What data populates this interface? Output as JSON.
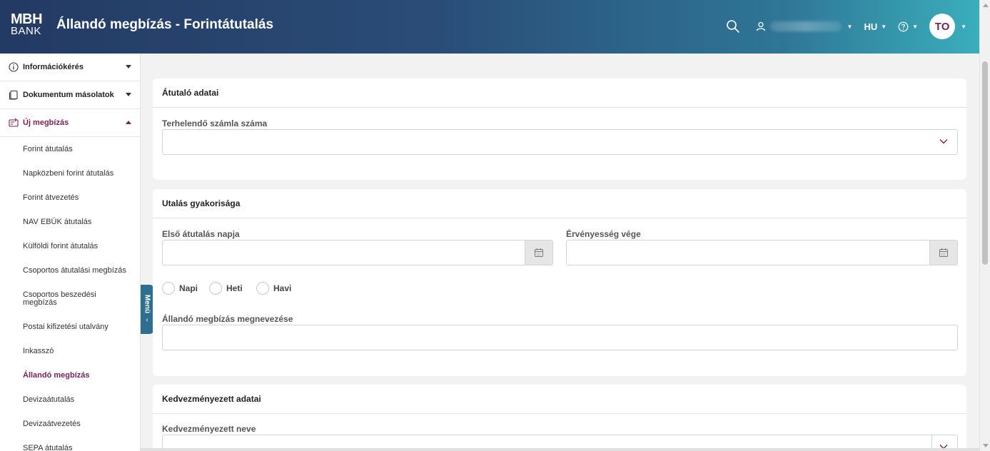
{
  "header": {
    "logo_line1": "MBH",
    "logo_line2": "BANK",
    "title": "Állandó megbízás - Forintátutalás",
    "language": "HU",
    "avatar_initials": "TO"
  },
  "sidebar": {
    "groups": [
      {
        "label": "Információkérés"
      },
      {
        "label": "Dokumentum másolatok"
      },
      {
        "label": "Új megbízás"
      }
    ],
    "items": [
      {
        "label": "Forint átutalás"
      },
      {
        "label": "Napközbeni forint átutalás"
      },
      {
        "label": "Forint átvezetés"
      },
      {
        "label": "NAV EBÜK átutalás"
      },
      {
        "label": "Külföldi forint átutalás"
      },
      {
        "label": "Csoportos átutalási megbízás"
      },
      {
        "label": "Csoportos beszedési megbízás"
      },
      {
        "label": "Postai kifizetési utalvány"
      },
      {
        "label": "Inkasszó"
      },
      {
        "label": "Állandó megbízás"
      },
      {
        "label": "Devizaátutalás"
      },
      {
        "label": "Devizaátvezetés"
      },
      {
        "label": "SEPA átutalás"
      }
    ],
    "menu_tab_label": "Menü"
  },
  "sections": {
    "payer": {
      "title": "Átutaló adatai",
      "account_label": "Terhelendő számla száma",
      "account_value": ""
    },
    "frequency": {
      "title": "Utalás gyakorisága",
      "first_date_label": "Első átutalás napja",
      "first_date_value": "",
      "validity_end_label": "Érvényesség vége",
      "validity_end_value": "",
      "options": [
        "Napi",
        "Heti",
        "Havi"
      ],
      "name_label": "Állandó megbízás megnevezése",
      "name_value": ""
    },
    "beneficiary": {
      "title": "Kedvezményezett adatai",
      "name_label": "Kedvezményezett neve",
      "name_value": ""
    }
  },
  "colors": {
    "accent": "#7a1f56",
    "header_start": "#233a63",
    "header_end": "#3aaebc",
    "menu_tab": "#2e6e8e"
  },
  "icons": [
    "search-icon",
    "user-icon",
    "help-icon",
    "info-icon",
    "document-icon",
    "new-order-icon",
    "calendar-icon",
    "chevron-down-icon"
  ]
}
